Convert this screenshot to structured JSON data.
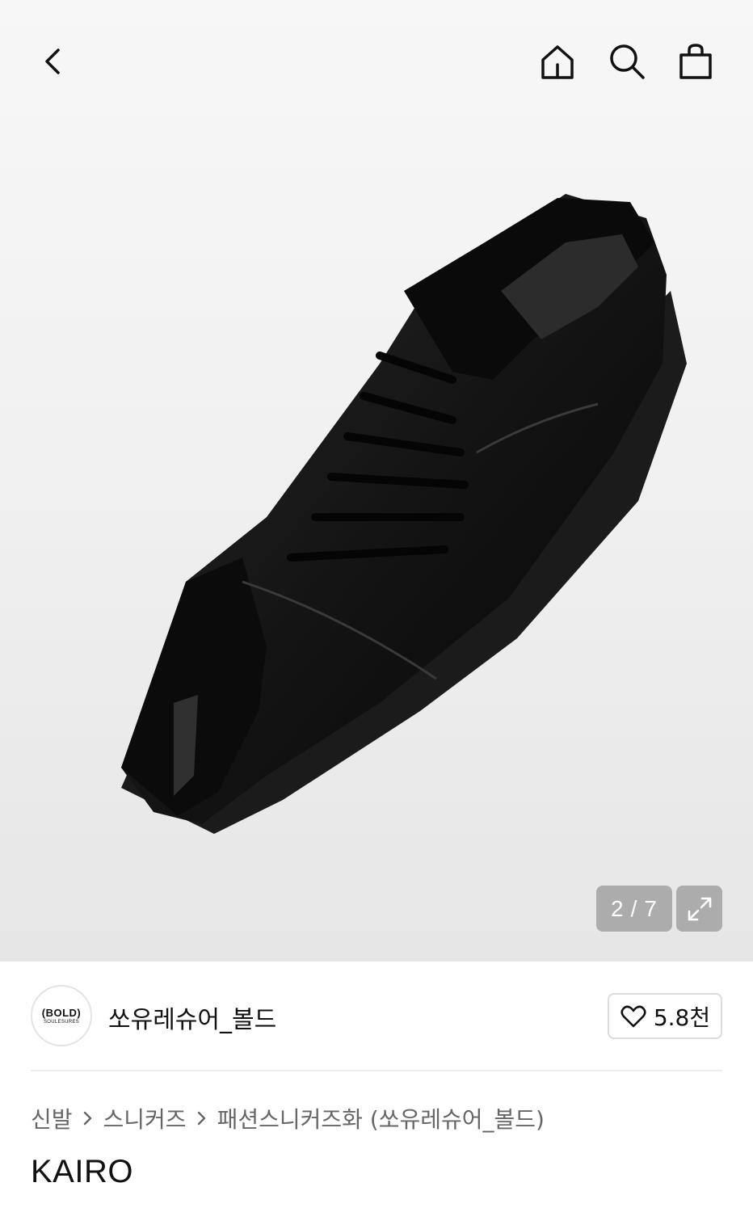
{
  "header": {
    "back_icon": "chevron-left-icon",
    "home_icon": "home-icon",
    "search_icon": "search-icon",
    "cart_icon": "shopping-bag-icon"
  },
  "gallery": {
    "current": "2",
    "total": "7",
    "separator": "/",
    "expand_icon": "expand-icon"
  },
  "brand": {
    "logo_text": "(BOLD)",
    "logo_subtext": "SOULESURES",
    "name": "쏘유레슈어_볼드",
    "like_icon": "heart-icon",
    "like_count": "5.8천"
  },
  "breadcrumb": {
    "items": [
      "신발",
      "스니커즈",
      "패션스니커즈화 (쏘유레슈어_볼드)"
    ],
    "separator_icon": "chevron-right-icon"
  },
  "product": {
    "title": "KAIRO"
  }
}
